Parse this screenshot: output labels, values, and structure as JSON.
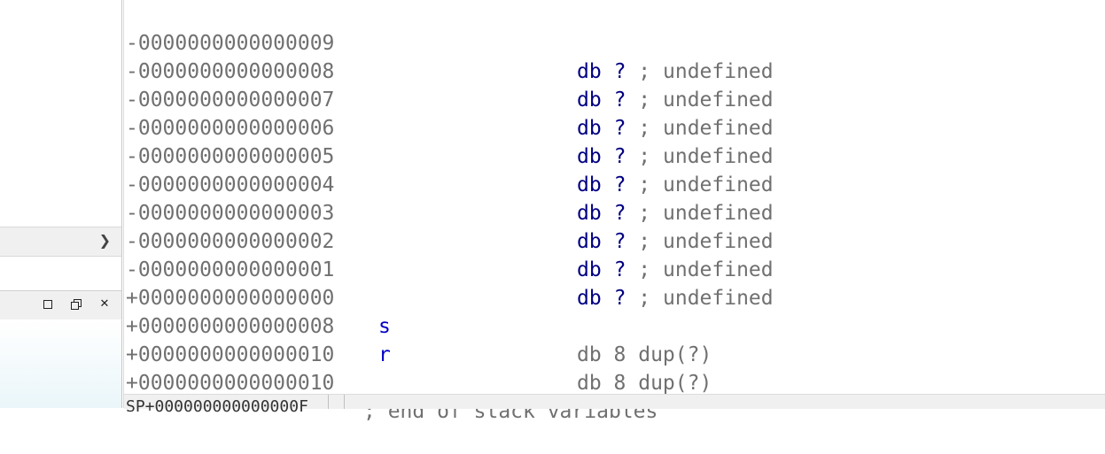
{
  "sidebar": {
    "expander_icon": "chevron-right-icon",
    "window_controls": {
      "minimize_icon": "minimize-icon",
      "restore_icon": "restore-icon",
      "close_glyph": "✕"
    }
  },
  "listing": {
    "undefined_rows": [
      {
        "offset": "-0000000000000009",
        "db": "db",
        "q": "?",
        "semi": ";",
        "comment": "undefined"
      },
      {
        "offset": "-0000000000000008",
        "db": "db",
        "q": "?",
        "semi": ";",
        "comment": "undefined"
      },
      {
        "offset": "-0000000000000007",
        "db": "db",
        "q": "?",
        "semi": ";",
        "comment": "undefined"
      },
      {
        "offset": "-0000000000000006",
        "db": "db",
        "q": "?",
        "semi": ";",
        "comment": "undefined"
      },
      {
        "offset": "-0000000000000005",
        "db": "db",
        "q": "?",
        "semi": ";",
        "comment": "undefined"
      },
      {
        "offset": "-0000000000000004",
        "db": "db",
        "q": "?",
        "semi": ";",
        "comment": "undefined"
      },
      {
        "offset": "-0000000000000003",
        "db": "db",
        "q": "?",
        "semi": ";",
        "comment": "undefined"
      },
      {
        "offset": "-0000000000000002",
        "db": "db",
        "q": "?",
        "semi": ";",
        "comment": "undefined"
      },
      {
        "offset": "-0000000000000001",
        "db": "db",
        "q": "?",
        "semi": ";",
        "comment": "undefined"
      }
    ],
    "var_rows": [
      {
        "offset": "+0000000000000000",
        "name": "s",
        "decl": "db 8 dup(?)"
      },
      {
        "offset": "+0000000000000008",
        "name": "r",
        "decl": "db 8 dup(?)"
      }
    ],
    "end_offset_row": "+0000000000000010",
    "end_comment_row": {
      "offset": "+0000000000000010",
      "comment": "; end of stack variables"
    }
  },
  "status_bar": {
    "text": "SP+000000000000000F"
  },
  "colors": {
    "offset_gray": "#707070",
    "keyword_navy": "#000080",
    "name_blue": "#0000c8"
  }
}
